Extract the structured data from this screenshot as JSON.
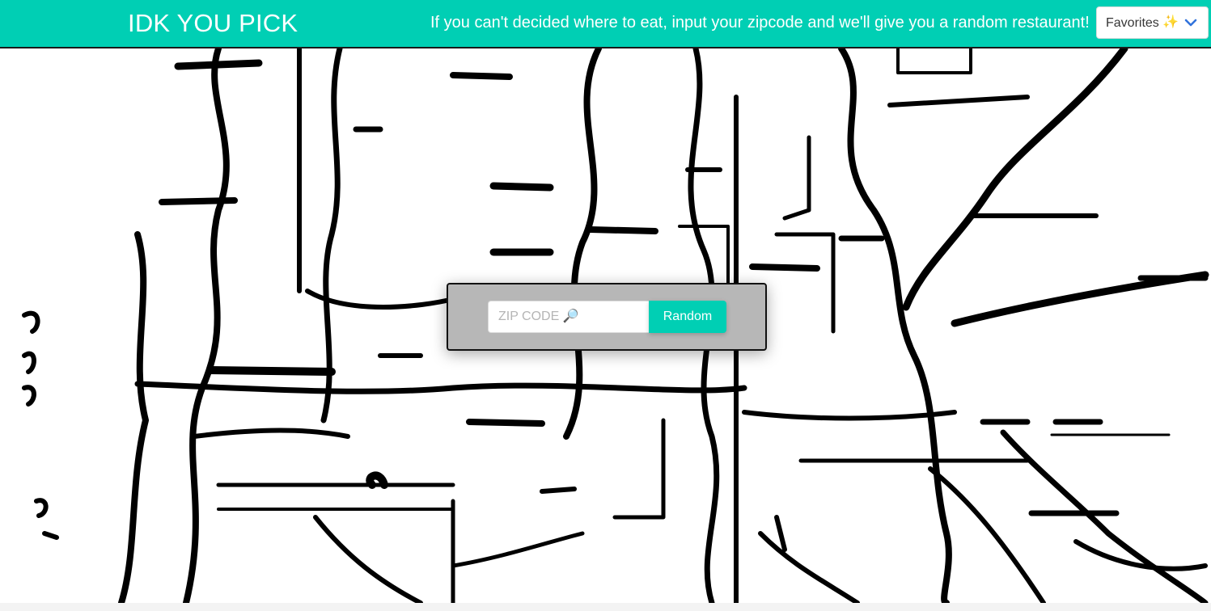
{
  "navbar": {
    "brand": "IDK YOU PICK",
    "tagline": "If you can't decided where to eat, input your zipcode and we'll give you a random restaurant!",
    "favorites": {
      "selected_label": "Favorites",
      "sparkle_glyph": "✨",
      "icon": "chevron-down-icon"
    }
  },
  "search": {
    "placeholder": "ZIP CODE 🔎",
    "value": "",
    "button_label": "Random"
  },
  "colors": {
    "accent": "#00cfb4",
    "search_panel": "#b7b7b7",
    "chevron": "#3273dc"
  },
  "background": {
    "icon": "city-map-line-art"
  }
}
